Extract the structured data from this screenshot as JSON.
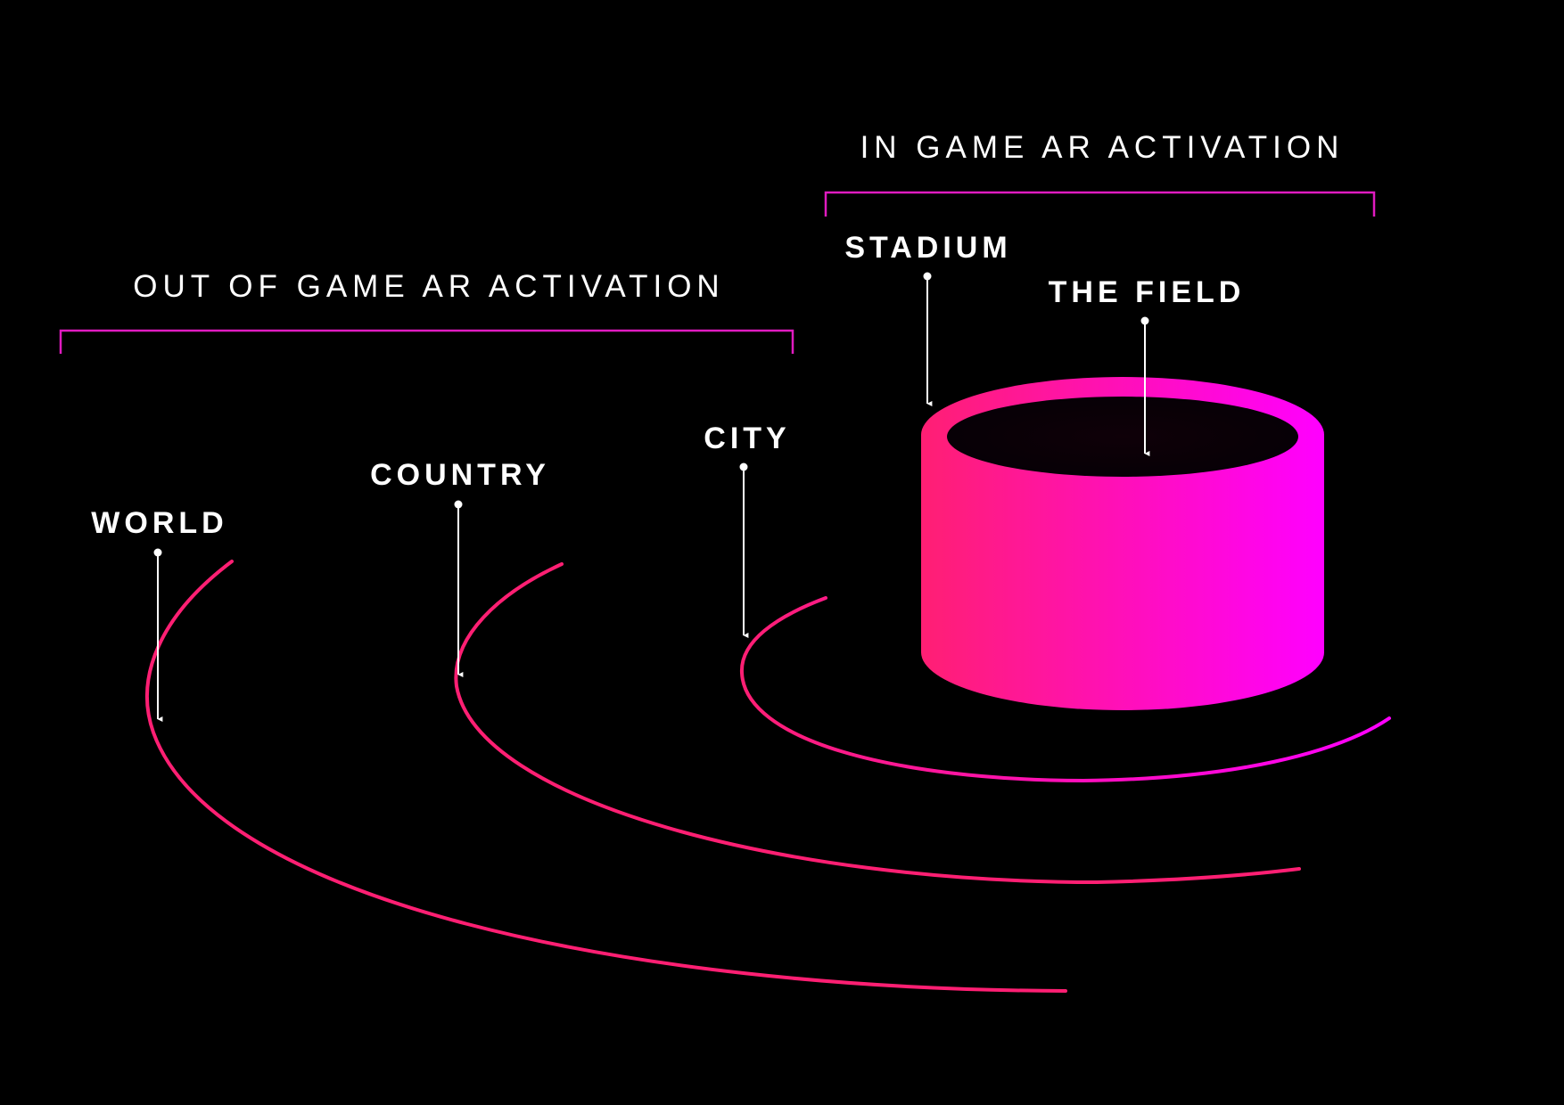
{
  "colors": {
    "background": "#000000",
    "accent_pink": "#ff1f73",
    "accent_magenta": "#ff00ff",
    "bracket": "#e01bc0",
    "text": "#ffffff"
  },
  "groups": {
    "in_game": {
      "title": "IN GAME AR ACTIVATION"
    },
    "out_of_game": {
      "title": "OUT OF GAME AR ACTIVATION"
    }
  },
  "levels": {
    "world": "WORLD",
    "country": "COUNTRY",
    "city": "CITY",
    "stadium": "STADIUM",
    "field": "THE FIELD"
  }
}
